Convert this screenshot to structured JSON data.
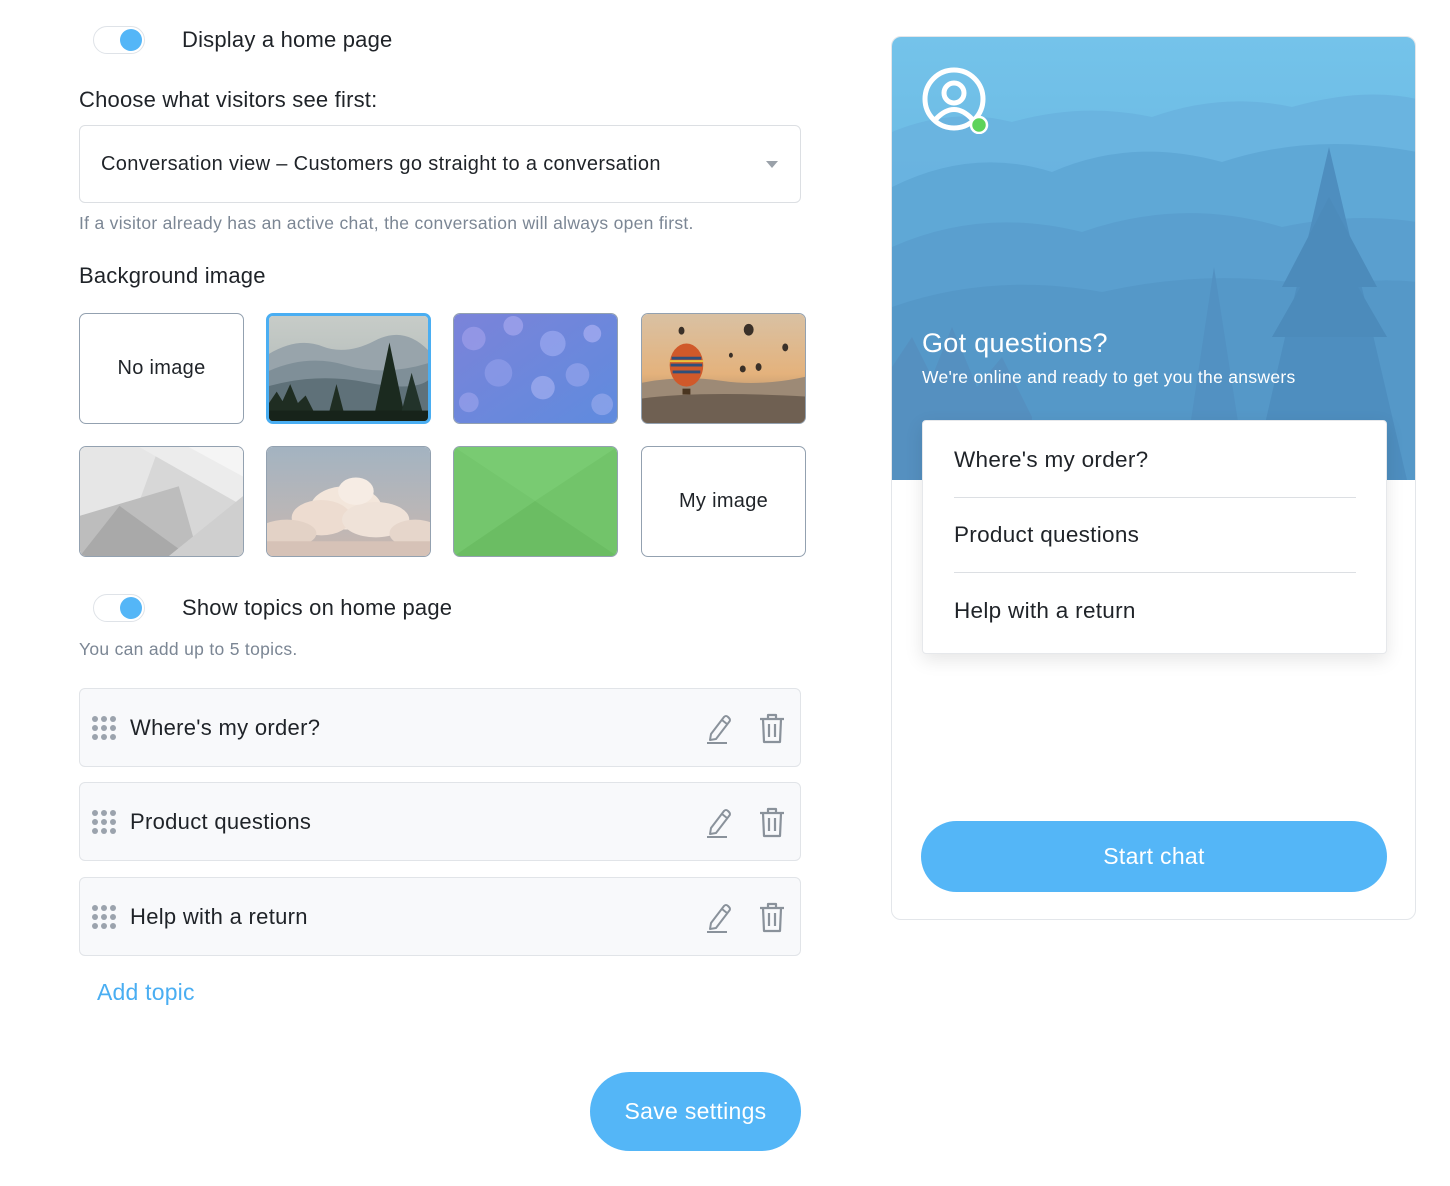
{
  "settings": {
    "home_page_toggle": {
      "label": "Display a home page",
      "on": true
    },
    "first_view": {
      "label": "Choose what visitors see first:",
      "selected": "Conversation view – Customers go straight to a conversation",
      "hint": "If a visitor already has an active chat, the conversation will always open first."
    },
    "background": {
      "label": "Background image",
      "options": [
        {
          "label": "No image",
          "icon": "none"
        },
        {
          "label": "",
          "icon": "mountains-image",
          "selected": true
        },
        {
          "label": "",
          "icon": "bokeh-image"
        },
        {
          "label": "",
          "icon": "balloons-image"
        },
        {
          "label": "",
          "icon": "grey-abstract-image"
        },
        {
          "label": "",
          "icon": "clouds-image"
        },
        {
          "label": "",
          "icon": "green-image"
        },
        {
          "label": "My image",
          "icon": "none"
        }
      ]
    },
    "topics_toggle": {
      "label": "Show topics on home page",
      "on": true
    },
    "topics_hint": "You can add up to 5 topics.",
    "topics": [
      {
        "label": "Where's my order?"
      },
      {
        "label": "Product questions"
      },
      {
        "label": "Help with a return"
      }
    ],
    "add_topic": "Add topic",
    "save": "Save settings"
  },
  "preview": {
    "title": "Got questions?",
    "subtitle": "We're online and ready to get you the answers",
    "topics": [
      {
        "label": "Where's my order?"
      },
      {
        "label": "Product questions"
      },
      {
        "label": "Help with a return"
      }
    ],
    "start_chat": "Start chat",
    "status": "online"
  },
  "colors": {
    "accent": "#54b6f7",
    "link": "#4aaef2",
    "online": "#5ed35a",
    "hint": "#7b8694"
  }
}
